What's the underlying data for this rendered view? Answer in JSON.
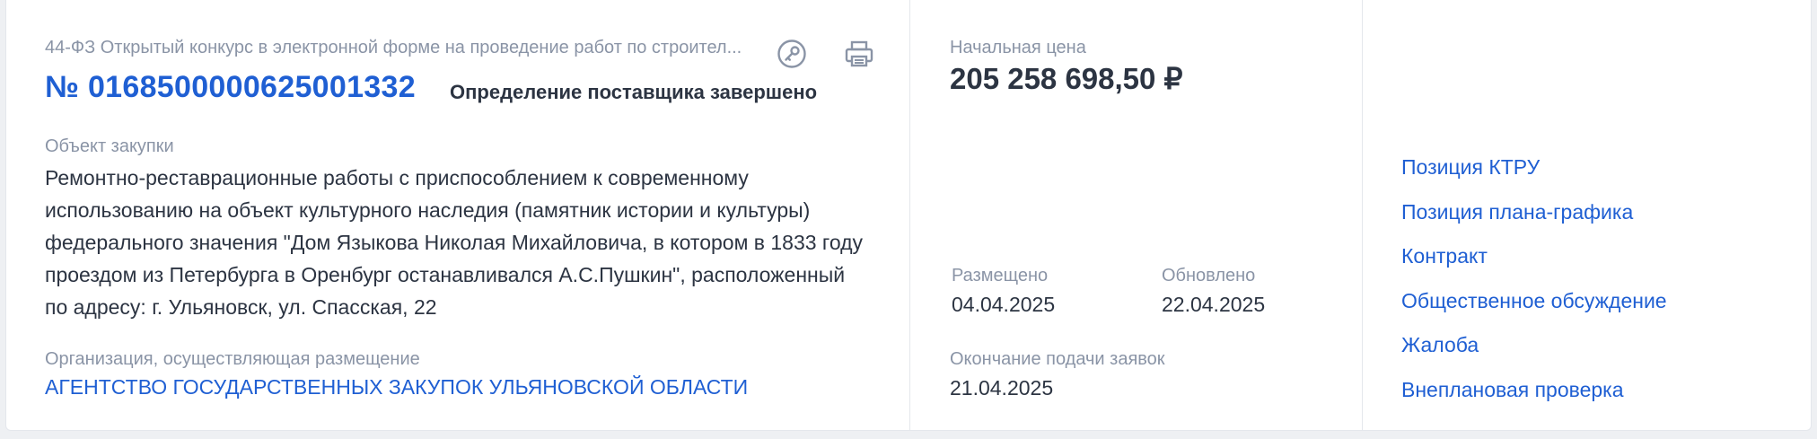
{
  "card": {
    "procurement_type": "44-ФЗ Открытый конкурс в электронной форме на проведение работ по строител...",
    "reg_number": "№ 0168500000625001332",
    "status": "Определение поставщика завершено",
    "object_label": "Объект закупки",
    "object_text": "Ремонтно-реставрационные работы с приспособлением к современному использованию на объект культурного наследия (памятник истории и культуры) федерального значения \"Дом Языкова Николая Михайловича, в котором в 1833 году проездом из Петербурга в Оренбург останавливался А.С.Пушкин\", расположенный по адресу: г. Ульяновск, ул. Спасская, 22",
    "org_label": "Организация, осуществляющая размещение",
    "org_name": "АГЕНТСТВО ГОСУДАРСТВЕННЫХ ЗАКУПОК УЛЬЯНОВСКОЙ ОБЛАСТИ",
    "icons": [
      "key-icon",
      "printer-icon"
    ]
  },
  "price": {
    "label": "Начальная цена",
    "value": "205 258 698,50 ₽"
  },
  "dates": {
    "placed_label": "Размещено",
    "placed_value": "04.04.2025",
    "updated_label": "Обновлено",
    "updated_value": "22.04.2025",
    "deadline_label": "Окончание подачи заявок",
    "deadline_value": "21.04.2025"
  },
  "links": [
    "Позиция КТРУ",
    "Позиция плана-графика",
    "Контракт",
    "Общественное обсуждение",
    "Жалоба",
    "Внеплановая проверка"
  ],
  "colors": {
    "accent": "#1f5fd3",
    "text": "#2c3442",
    "muted": "#8a94a6",
    "background": "#eef0f3"
  }
}
